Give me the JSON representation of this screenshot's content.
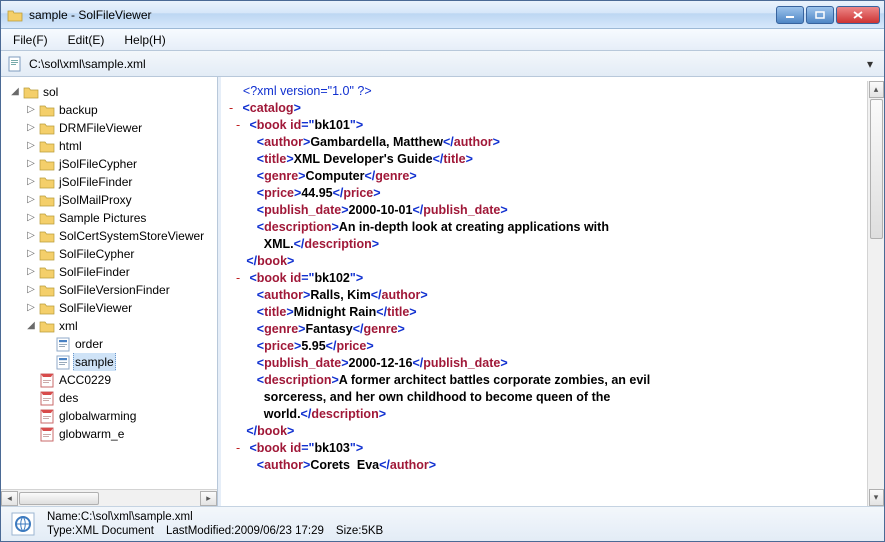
{
  "window": {
    "title": "sample - SolFileViewer"
  },
  "menu": {
    "file": "File(F)",
    "edit": "Edit(E)",
    "help": "Help(H)"
  },
  "path": {
    "text": "C:\\sol\\xml\\sample.xml"
  },
  "tree": {
    "root": "sol",
    "folders": [
      "backup",
      "DRMFileViewer",
      "html",
      "jSolFileCypher",
      "jSolFileFinder",
      "jSolMailProxy",
      "Sample Pictures",
      "SolCertSystemStoreViewer",
      "SolFileCypher",
      "SolFileFinder",
      "SolFileVersionFinder",
      "SolFileViewer"
    ],
    "xml_folder": "xml",
    "xml_children": [
      {
        "label": "order",
        "kind": "html"
      },
      {
        "label": "sample",
        "kind": "html",
        "selected": true
      }
    ],
    "after": [
      {
        "label": "ACC0229",
        "kind": "pdf"
      },
      {
        "label": "des",
        "kind": "pdf"
      },
      {
        "label": "globalwarming",
        "kind": "pdf"
      },
      {
        "label": "globwarm_e",
        "kind": "pdf"
      }
    ]
  },
  "xml": {
    "pi": "<?xml version=\"1.0\" ?>",
    "root_open": "catalog",
    "books": [
      {
        "id": "bk101",
        "author": "Gambardella, Matthew",
        "title": "XML Developer's Guide",
        "genre": "Computer",
        "price": "44.95",
        "publish_date": "2000-10-01",
        "description_line1": "An in-depth look at creating applications with",
        "description_line2": "XML."
      },
      {
        "id": "bk102",
        "author": "Ralls, Kim",
        "title": "Midnight Rain",
        "genre": "Fantasy",
        "price": "5.95",
        "publish_date": "2000-12-16",
        "description_line1": "A former architect battles corporate zombies, an evil",
        "description_line2": "sorceress, and her own childhood to become queen of the",
        "description_line3": "world."
      },
      {
        "id": "bk103",
        "author_partial": "Corets  Eva"
      }
    ]
  },
  "status": {
    "name_label": "Name:",
    "name_value": "C:\\sol\\xml\\sample.xml",
    "type_label": "Type:",
    "type_value": "XML Document",
    "mod_label": "LastModified:",
    "mod_value": "2009/06/23 17:29",
    "size_label": "Size:",
    "size_value": "5KB"
  }
}
